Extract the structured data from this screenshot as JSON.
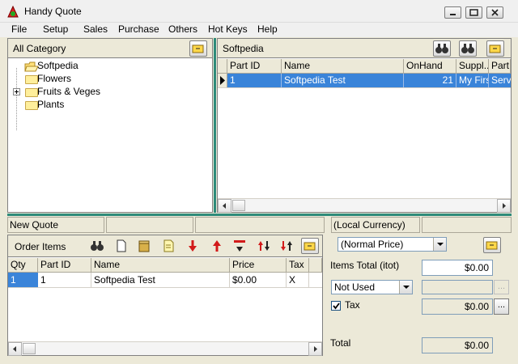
{
  "window": {
    "title": "Handy Quote"
  },
  "menu": [
    "File",
    "Setup",
    "Sales",
    "Purchase",
    "Others",
    "Hot Keys",
    "Help"
  ],
  "left_panel": {
    "header": "All Category",
    "tree": [
      {
        "label": "Softpedia",
        "icon": "open-folder-icon",
        "expander": false
      },
      {
        "label": "Flowers",
        "icon": "folder-icon",
        "expander": false
      },
      {
        "label": "Fruits & Veges",
        "icon": "folder-icon",
        "expander": true
      },
      {
        "label": "Plants",
        "icon": "folder-icon",
        "expander": false
      }
    ]
  },
  "right_panel": {
    "header": "Softpedia",
    "columns": [
      "Part ID",
      "Name",
      "OnHand",
      "Suppl...",
      "Part"
    ],
    "rows": [
      {
        "part_id": "1",
        "name": "Softpedia Test",
        "onhand": "21",
        "supplier": "My First",
        "part": "Serv"
      }
    ]
  },
  "status": {
    "left": "New Quote",
    "right": "(Local Currency)"
  },
  "order_items": {
    "header": "Order Items",
    "columns": [
      "Qty",
      "Part ID",
      "Name",
      "Price",
      "Tax"
    ],
    "rows": [
      {
        "qty": "1",
        "part_id": "1",
        "name": "Softpedia Test",
        "price": "$0.00",
        "tax": "X"
      }
    ]
  },
  "totals": {
    "price_list": "(Normal Price)",
    "items_total_label": "Items Total (itot)",
    "items_total": "$0.00",
    "discount_select": "Not Used",
    "tax_label": "Tax",
    "tax_checked": true,
    "tax_value": "$0.00",
    "total_label": "Total",
    "total_value": "$0.00",
    "ellipsis": "..."
  },
  "colors": {
    "selection": "#3a84d9",
    "splitter": "#2e8b7a"
  }
}
